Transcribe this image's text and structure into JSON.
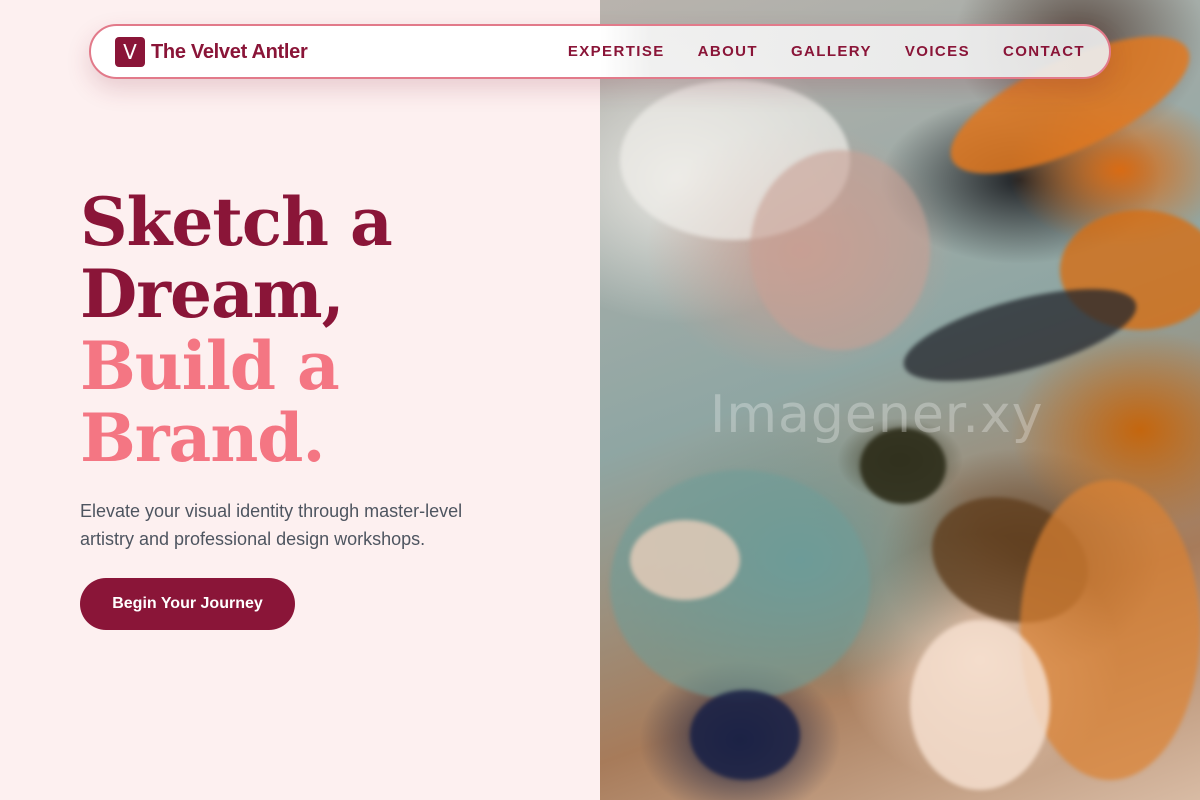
{
  "brand": {
    "logo_letter": "V",
    "name": "The Velvet Antler"
  },
  "nav": {
    "items": [
      {
        "label": "EXPERTISE"
      },
      {
        "label": "ABOUT"
      },
      {
        "label": "GALLERY"
      },
      {
        "label": "VOICES"
      },
      {
        "label": "CONTACT"
      }
    ]
  },
  "hero": {
    "title_lines": [
      "Sketch a",
      "Dream,"
    ],
    "accent_lines": [
      "Build a",
      "Brand."
    ],
    "subtitle": "Elevate your visual identity through master-level artistry and professional design workshops.",
    "cta_label": "Begin Your Journey"
  },
  "image": {
    "description_icon": "painting-texture-image",
    "watermark": "Imagener.xy"
  },
  "colors": {
    "primary": "#8a1538",
    "accent": "#f47683",
    "background": "#fdf0f0",
    "text_muted": "#4e5560"
  }
}
